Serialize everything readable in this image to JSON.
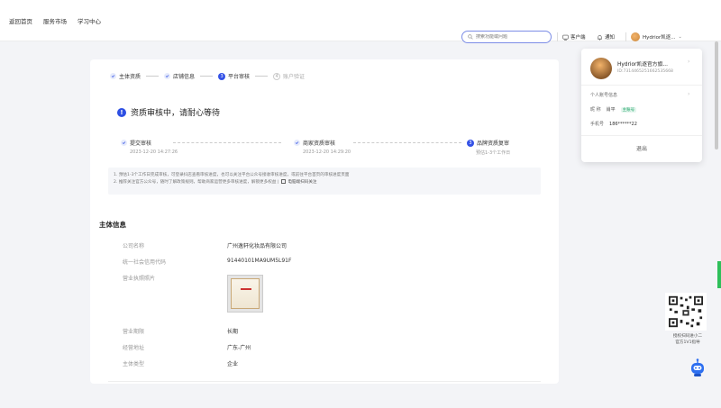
{
  "nav": {
    "items": [
      "返回首页",
      "服务市场",
      "学习中心"
    ],
    "search_placeholder": "搜索功能或问题",
    "client_label": "客户端",
    "notify_label": "通知",
    "user_name": "Hydrior凯逐...",
    "colors": {
      "accent": "#3452e6",
      "search_border": "#7c8de6"
    }
  },
  "steps": [
    {
      "label": "主体资质",
      "state": "done"
    },
    {
      "label": "店铺信息",
      "state": "done"
    },
    {
      "label": "平台审核",
      "state": "current",
      "num": "3"
    },
    {
      "label": "账户验证",
      "state": "todo",
      "num": "4"
    }
  ],
  "status": {
    "title": "资质审核中，请耐心等待",
    "icon": "!"
  },
  "timeline": [
    {
      "label": "提交审核",
      "time": "2023-12-20 14:27:26",
      "state": "done"
    },
    {
      "label": "商家资质审核",
      "time": "2023-12-20 14:29:20",
      "state": "done"
    },
    {
      "label": "品牌资质复审",
      "time": "预估1-3个工作日",
      "state": "current",
      "num": "3"
    }
  ],
  "notice": {
    "line1": "1. 预估1-3个工作日完成审核，可登录抖店查看审核进度，也可以关注平台公众号接收审核进度，或前往平台首页的审核进度页面",
    "line2": "2. 推荐关注官方公众号，随时了解政策规则，帮助商家运营更多审核进度，解锁更多权益 |",
    "line2_link": "电脑端扫码关注"
  },
  "section": {
    "title": "主体信息"
  },
  "fields": [
    {
      "label": "公司名称",
      "value": "广州逸轩化妆品有限公司"
    },
    {
      "label": "统一社会信用代码",
      "value": "91440101MA9UM5L91F"
    },
    {
      "label": "营业执照照片",
      "value": ""
    },
    {
      "label": "营业期限",
      "value": "长期"
    },
    {
      "label": "经营地址",
      "value": "广东-广州"
    },
    {
      "label": "主体类型",
      "value": "企业"
    }
  ],
  "popover": {
    "name": "Hydrior凯逐官方旗...",
    "id": "ID:7314465251662535668",
    "account_info": "个人账号信息",
    "nickname_label": "昵  称",
    "nickname_value": "肖平",
    "badge": "主账号",
    "phone_label": "手机号",
    "phone_value": "186******22",
    "logout": "退出"
  },
  "qr": {
    "line1": "授权扫码进小二",
    "line2": "官方1V1指导"
  }
}
